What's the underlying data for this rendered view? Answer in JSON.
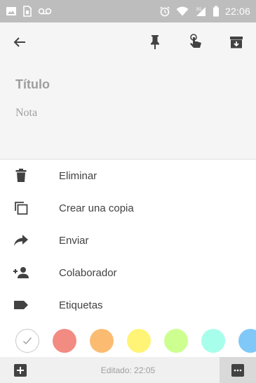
{
  "status_bar": {
    "time": "22:06",
    "left_icons": [
      "image-icon",
      "sim-card-icon",
      "voicemail-icon"
    ],
    "right_icons": [
      "alarm-icon",
      "wifi-icon",
      "signal-3g-icon",
      "battery-icon"
    ]
  },
  "toolbar": {
    "back_icon": "arrow-back-icon",
    "actions": [
      "pin-icon",
      "touch-reminder-icon",
      "archive-icon"
    ]
  },
  "note": {
    "title_placeholder": "Título",
    "body_placeholder": "Nota"
  },
  "menu": {
    "items": [
      {
        "label": "Eliminar",
        "icon": "trash-icon"
      },
      {
        "label": "Crear una copia",
        "icon": "copy-icon"
      },
      {
        "label": "Enviar",
        "icon": "share-icon"
      },
      {
        "label": "Colaborador",
        "icon": "add-person-icon"
      },
      {
        "label": "Etiquetas",
        "icon": "label-icon"
      }
    ]
  },
  "colors": {
    "swatches": [
      "#ffffff",
      "#f28b82",
      "#fbbc72",
      "#fff475",
      "#ccff90",
      "#a7ffeb",
      "#7fc8f8"
    ],
    "selected": "#ffffff"
  },
  "bottom_bar": {
    "edited_text": "Editado: 22:05",
    "add_icon": "add-box-icon",
    "more_icon": "more-horiz-icon"
  }
}
